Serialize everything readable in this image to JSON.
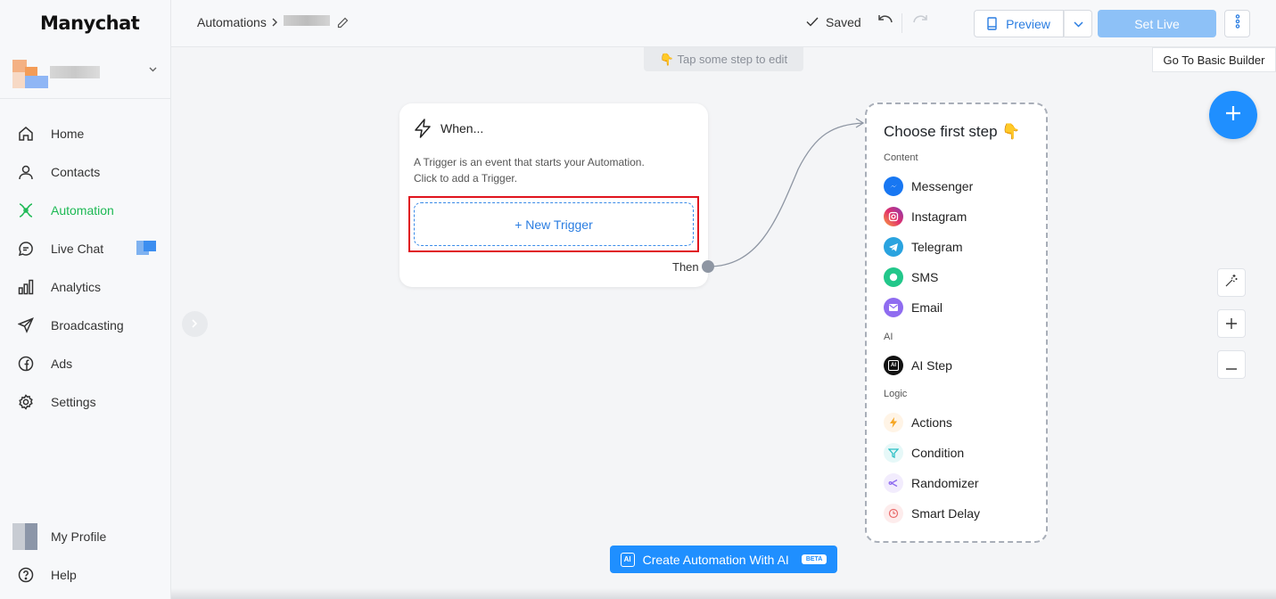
{
  "app": {
    "logo": "Manychat"
  },
  "sidebar": {
    "items": [
      {
        "label": "Home",
        "icon": "home-icon"
      },
      {
        "label": "Contacts",
        "icon": "person-icon"
      },
      {
        "label": "Automation",
        "icon": "automation-icon",
        "active": true
      },
      {
        "label": "Live Chat",
        "icon": "chat-icon"
      },
      {
        "label": "Analytics",
        "icon": "bar-chart-icon"
      },
      {
        "label": "Broadcasting",
        "icon": "send-icon"
      },
      {
        "label": "Ads",
        "icon": "facebook-icon"
      },
      {
        "label": "Settings",
        "icon": "gear-icon"
      }
    ],
    "bottom": [
      {
        "label": "My Profile",
        "icon": "avatar"
      },
      {
        "label": "Help",
        "icon": "help-icon"
      }
    ],
    "active_color": "#1db954"
  },
  "topbar": {
    "breadcrumb_root": "Automations",
    "saved_label": "Saved",
    "preview_label": "Preview",
    "set_live_label": "Set Live"
  },
  "canvas": {
    "tap_hint": "👇 Tap some step to edit",
    "basic_builder": "Go To Basic Builder",
    "trigger_card": {
      "title": "When...",
      "desc_line1": "A Trigger is an event that starts your Automation.",
      "desc_line2": "Click to add a Trigger.",
      "new_trigger_label": "+ New Trigger",
      "then_label": "Then"
    },
    "choose": {
      "title": "Choose first step 👇",
      "sections": {
        "content": "Content",
        "ai": "AI",
        "logic": "Logic"
      },
      "content_items": [
        "Messenger",
        "Instagram",
        "Telegram",
        "SMS",
        "Email"
      ],
      "ai_items": [
        "AI Step"
      ],
      "logic_items": [
        "Actions",
        "Condition",
        "Randomizer",
        "Smart Delay"
      ]
    },
    "ai_button": {
      "label": "Create Automation With AI",
      "badge": "BETA",
      "icon_text": "AI"
    }
  },
  "colors": {
    "primary": "#1f8fff",
    "highlight": "#e0141e",
    "set_live_disabled": "#8dc1f7"
  }
}
